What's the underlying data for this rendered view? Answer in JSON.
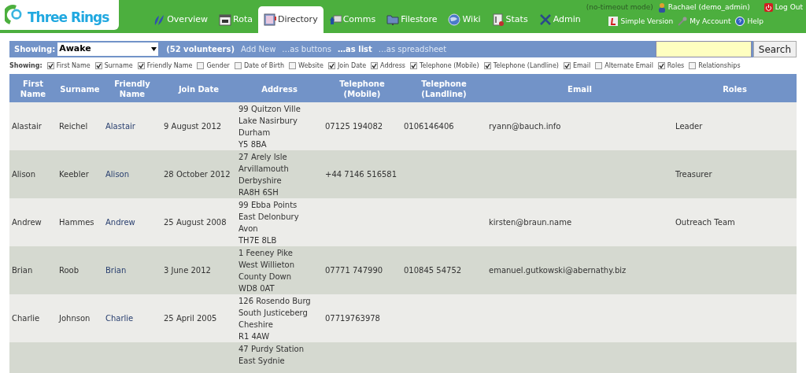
{
  "logo": {
    "text": "Three Rings"
  },
  "nav_tabs": [
    {
      "label": "Overview",
      "selected": false
    },
    {
      "label": "Rota",
      "selected": false
    },
    {
      "label": "Directory",
      "selected": true
    },
    {
      "label": "Comms",
      "selected": false
    },
    {
      "label": "Filestore",
      "selected": false
    },
    {
      "label": "Wiki",
      "selected": false
    },
    {
      "label": "Stats",
      "selected": false
    },
    {
      "label": "Admin",
      "selected": false
    }
  ],
  "user_bar": {
    "mode": "(no-timeout mode)",
    "user": "Rachael (demo_admin)",
    "logout": "Log Out",
    "links": [
      {
        "label": "Simple Version"
      },
      {
        "label": "My Account"
      },
      {
        "label": "Help"
      }
    ]
  },
  "toolbar": {
    "showing_label": "Showing:",
    "filter": "Awake",
    "count": "(52 volunteers)",
    "links": [
      {
        "label": "Add New",
        "selected": false
      },
      {
        "label": "…as buttons",
        "selected": false
      },
      {
        "label": "…as list",
        "selected": true
      },
      {
        "label": "…as spreadsheet",
        "selected": false
      }
    ],
    "search_button": "Search"
  },
  "columns_filter": {
    "label": "Showing:",
    "options": [
      {
        "label": "First Name",
        "checked": true
      },
      {
        "label": "Surname",
        "checked": true
      },
      {
        "label": "Friendly Name",
        "checked": true
      },
      {
        "label": "Gender",
        "checked": false
      },
      {
        "label": "Date of Birth",
        "checked": false
      },
      {
        "label": "Website",
        "checked": false
      },
      {
        "label": "Join Date",
        "checked": true
      },
      {
        "label": "Address",
        "checked": true
      },
      {
        "label": "Telephone (Mobile)",
        "checked": true
      },
      {
        "label": "Telephone (Landline)",
        "checked": true
      },
      {
        "label": "Email",
        "checked": true
      },
      {
        "label": "Alternate Email",
        "checked": false
      },
      {
        "label": "Roles",
        "checked": true
      },
      {
        "label": "Relationships",
        "checked": false
      }
    ]
  },
  "table": {
    "columns": [
      "First Name",
      "Surname",
      "Friendly Name",
      "Join Date",
      "Address",
      "Telephone (Mobile)",
      "Telephone (Landline)",
      "Email",
      "Roles"
    ],
    "rows": [
      {
        "first_name": "Alastair",
        "surname": "Reichel",
        "friendly_name": "Alastair",
        "join_date": "9 August 2012",
        "address": [
          "99 Quitzon Ville",
          "Lake Nasirbury",
          "Durham",
          "Y5 8BA"
        ],
        "mobile": "07125 194082",
        "landline": "0106146406",
        "email": "ryann@bauch.info",
        "roles": "Leader"
      },
      {
        "first_name": "Alison",
        "surname": "Keebler",
        "friendly_name": "Alison",
        "join_date": "28 October 2012",
        "address": [
          "27 Arely Isle",
          "Arvillamouth",
          "Derbyshire",
          "RA8H 6SH"
        ],
        "mobile": "+44 7146 516581",
        "roles": "Treasurer"
      },
      {
        "first_name": "Andrew",
        "surname": "Hammes",
        "friendly_name": "Andrew",
        "join_date": "25 August 2008",
        "address": [
          "99 Ebba Points",
          "East Delonbury",
          "Avon",
          "TH7E 8LB"
        ],
        "email": "kirsten@braun.name",
        "roles": "Outreach Team"
      },
      {
        "first_name": "Brian",
        "surname": "Roob",
        "friendly_name": "Brian",
        "join_date": "3 June 2012",
        "address": [
          "1 Feeney Pike",
          "West Willieton",
          "County Down",
          "WD8 0AT"
        ],
        "mobile": "07771 747990",
        "landline": "010845 54752",
        "email": "emanuel.gutkowski@abernathy.biz"
      },
      {
        "first_name": "Charlie",
        "surname": "Johnson",
        "friendly_name": "Charlie",
        "join_date": "25 April 2005",
        "address": [
          "126 Rosendo Burg",
          "South Justiceberg",
          "Cheshire",
          "R1 4AW"
        ],
        "mobile": "07719763978"
      },
      {
        "address": [
          "47 Purdy Station",
          "East Sydnie"
        ]
      }
    ]
  }
}
